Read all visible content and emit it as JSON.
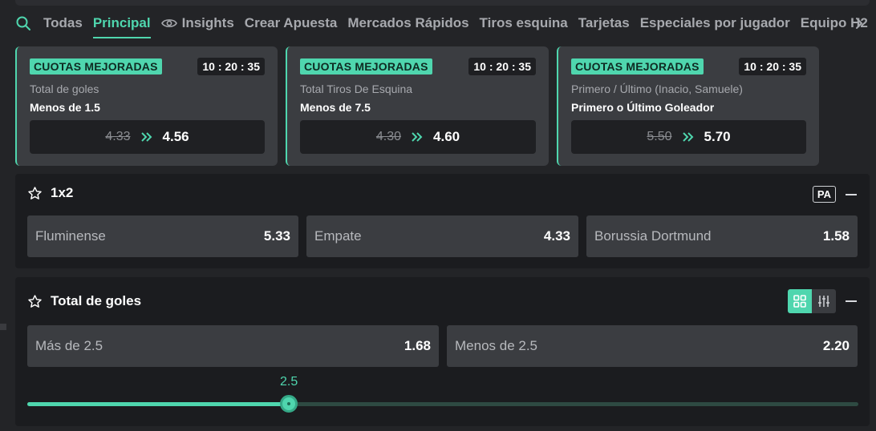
{
  "nav": {
    "tabs": [
      {
        "label": "Todas"
      },
      {
        "label": "Principal",
        "active": true
      },
      {
        "label": "Insights",
        "icon": "eye-icon"
      },
      {
        "label": "Crear Apuesta"
      },
      {
        "label": "Mercados Rápidos"
      },
      {
        "label": "Tiros esquina"
      },
      {
        "label": "Tarjetas"
      },
      {
        "label": "Especiales por jugador"
      },
      {
        "label": "Equipo H2"
      }
    ]
  },
  "promos": [
    {
      "badge": "CUOTAS MEJORADAS",
      "timer": "10 : 20 : 35",
      "market": "Total de goles",
      "selection": "Menos de 1.5",
      "old_odds": "4.33",
      "new_odds": "4.56"
    },
    {
      "badge": "CUOTAS MEJORADAS",
      "timer": "10 : 20 : 35",
      "market": "Total Tiros De Esquina",
      "selection": "Menos de 7.5",
      "old_odds": "4.30",
      "new_odds": "4.60"
    },
    {
      "badge": "CUOTAS MEJORADAS",
      "timer": "10 : 20 : 35",
      "market": "Primero / Último (Inacio, Samuele)",
      "selection": "Primero o Último Goleador",
      "old_odds": "5.50",
      "new_odds": "5.70"
    }
  ],
  "market_1x2": {
    "title": "1x2",
    "pa_label": "PA",
    "selections": [
      {
        "label": "Fluminense",
        "odds": "5.33"
      },
      {
        "label": "Empate",
        "odds": "4.33"
      },
      {
        "label": "Borussia Dortmund",
        "odds": "1.58"
      }
    ]
  },
  "market_goals": {
    "title": "Total de goles",
    "selections": [
      {
        "label": "Más de 2.5",
        "odds": "1.68"
      },
      {
        "label": "Menos de 2.5",
        "odds": "2.20"
      }
    ],
    "slider": {
      "value": "2.5",
      "fraction": 0.315
    }
  },
  "colors": {
    "accent": "#4fd6ae",
    "panel": "#1b1c1f",
    "button": "#3b3d41"
  }
}
